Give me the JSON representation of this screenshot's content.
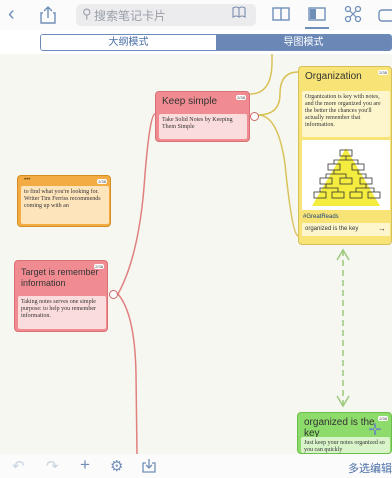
{
  "toolbar": {
    "back_icon": "chevron-left-icon",
    "share_icon": "share-icon",
    "search_placeholder": "搜索笔记卡片",
    "book_icon": "book-icon",
    "right_icons": [
      "open-book-icon",
      "sidebar-icon",
      "mind-map-icon",
      "card-icon"
    ]
  },
  "mode_switch": {
    "outline": "大纲模式",
    "mindmap": "导图模式",
    "active": "mindmap"
  },
  "cards": {
    "keep_simple": {
      "title": "Keep simple",
      "badge": "2/38",
      "body": "Take Solid Notes by Keeping Them Simple"
    },
    "organization": {
      "title": "Organization",
      "badge": "2/38",
      "body": "Organization is key with notes, and the more organized you are the better the chances you'll actually remember that information.",
      "tag": "#GreatReads",
      "link": "organized is the key"
    },
    "tim_ferriss": {
      "dots": "•••",
      "badge": "2/38",
      "body": "to find what you're looking for. Writer Tim Ferriss recommends coming up with an"
    },
    "target": {
      "title": "Target is remember information",
      "badge": "2/38",
      "body": "Taking notes serves one simple purpose: to help you remember information."
    },
    "organized_key": {
      "title": "organized is the key",
      "badge": "2/38",
      "body": "Just keep your notes organized so you can quickly"
    }
  },
  "bottom_bar": {
    "icons": [
      "undo-icon",
      "redo-icon",
      "add-icon",
      "settings-icon",
      "import-icon"
    ],
    "multi_edit": "多选编辑"
  },
  "colors": {
    "accent": "#6b87b6",
    "red_card": "#f08c91",
    "yellow_card": "#f8e476",
    "orange_card": "#f2ac43",
    "green_card": "#8ddb6a"
  }
}
